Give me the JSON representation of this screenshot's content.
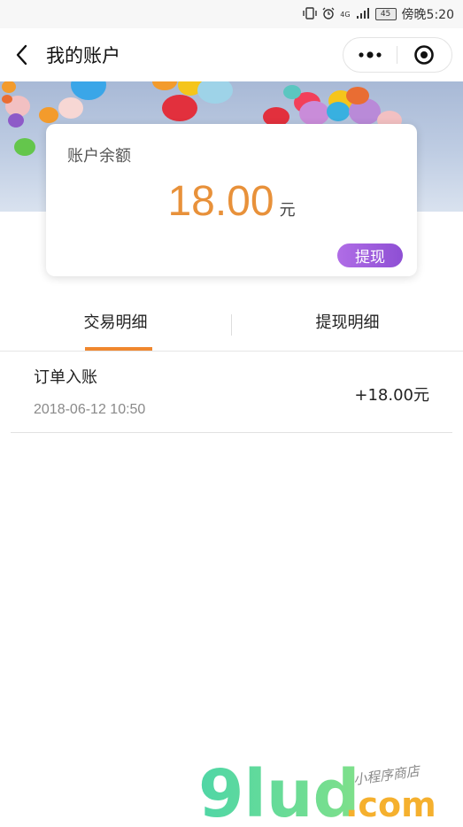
{
  "status_bar": {
    "network": "4G",
    "battery": "45",
    "time": "傍晚5:20"
  },
  "nav": {
    "title": "我的账户"
  },
  "account_card": {
    "label": "账户余额",
    "amount": "18.00",
    "unit": "元",
    "withdraw_label": "提现"
  },
  "tabs": [
    {
      "label": "交易明细",
      "active": true
    },
    {
      "label": "提现明细",
      "active": false
    }
  ],
  "transactions": [
    {
      "title": "订单入账",
      "time": "2018-06-12 10:50",
      "amount": "+18.00元"
    }
  ],
  "watermark": {
    "brand": "9lud",
    "domain": ".com",
    "tagline": "小程序商店"
  },
  "colors": {
    "accent_orange": "#e8913a",
    "tab_underline": "#f0872e",
    "withdraw_purple": "#9a5ad9"
  }
}
